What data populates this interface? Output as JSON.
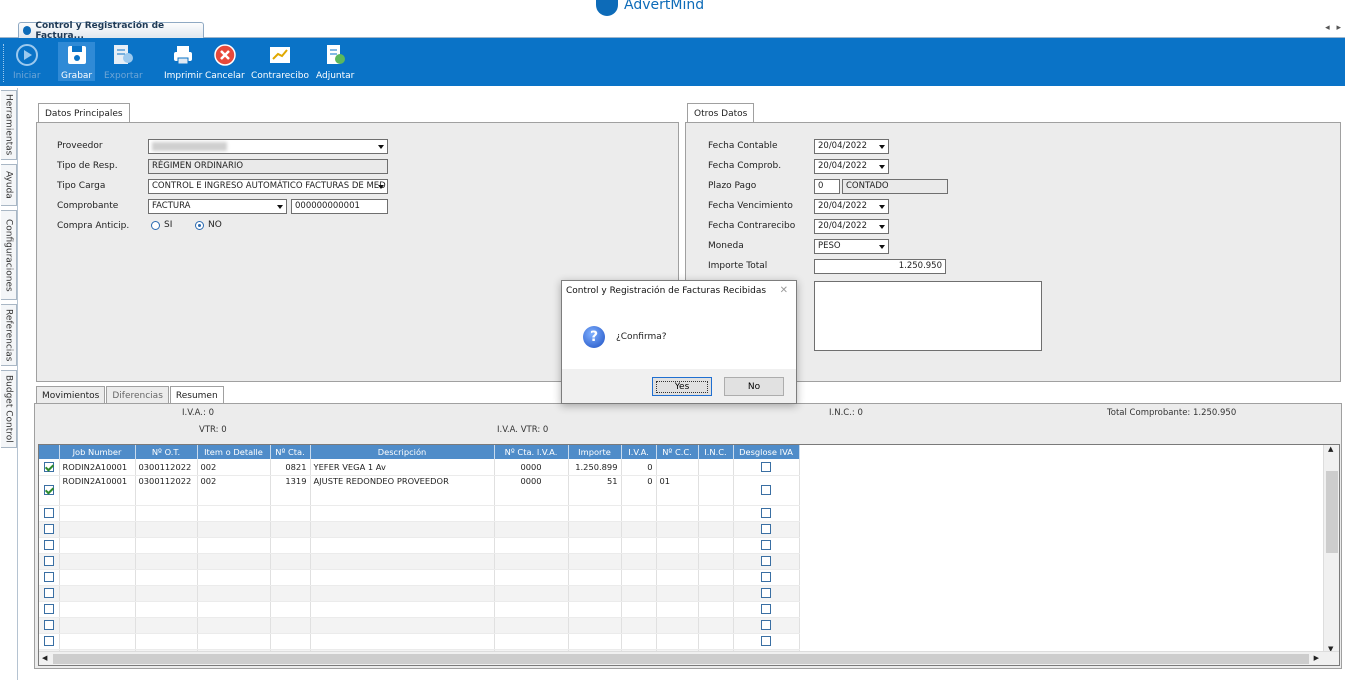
{
  "brand": {
    "name": "AdvertMind"
  },
  "window": {
    "tab_title": "Control y Registración de Factura...",
    "nav": "◂ ▸"
  },
  "toolbar": {
    "iniciar": "Iniciar",
    "grabar": "Grabar",
    "exportar": "Exportar",
    "imprimir": "Imprimir",
    "cancelar": "Cancelar",
    "contrarecibo": "Contrarecibo",
    "adjuntar": "Adjuntar"
  },
  "sidebar": {
    "tabs": [
      "Herramientas",
      "Ayuda",
      "Configuraciones",
      "Referencias",
      "Budget Control"
    ]
  },
  "datos_principales": {
    "tab": "Datos Principales",
    "proveedor_label": "Proveedor",
    "tipo_resp_label": "Tipo de Resp.",
    "tipo_resp_value": "RÉGIMEN ORDINARIO",
    "tipo_carga_label": "Tipo Carga",
    "tipo_carga_value": "CONTROL E INGRESO AUTOMÁTICO FACTURAS DE MED",
    "comprobante_label": "Comprobante",
    "comprobante_value": "FACTURA",
    "comprobante_num": "000000000001",
    "compra_label": "Compra Anticip.",
    "si": "SI",
    "no": "NO",
    "selected": "NO"
  },
  "otros_datos": {
    "tab": "Otros Datos",
    "fecha_contable_label": "Fecha Contable",
    "fecha_contable": "20/04/2022",
    "fecha_comprob_label": "Fecha Comprob.",
    "fecha_comprob": "20/04/2022",
    "plazo_label": "Plazo Pago",
    "plazo_value": "0",
    "plazo_desc": "CONTADO",
    "fecha_venc_label": "Fecha Vencimiento",
    "fecha_venc": "20/04/2022",
    "fecha_contra_label": "Fecha Contrarecibo",
    "fecha_contra": "20/04/2022",
    "moneda_label": "Moneda",
    "moneda": "PESO",
    "importe_label": "Importe Total",
    "importe": "1.250.950"
  },
  "bottom_tabs": [
    "Movimientos",
    "Diferencias",
    "Resumen"
  ],
  "resumen": {
    "iva": "I.V.A.: 0",
    "vtr": "VTR: 0",
    "iva_vtr": "I.V.A. VTR: 0",
    "inc": "I.N.C.: 0",
    "total": "Total Comprobante: 1.250.950"
  },
  "grid": {
    "columns": [
      "",
      "Job Number",
      "Nº O.T.",
      "Item o Detalle",
      "Nº Cta.",
      "Descripción",
      "Nº Cta. I.V.A.",
      "Importe",
      "I.V.A.",
      "Nº C.C.",
      "I.N.C.",
      "Desglose IVA"
    ],
    "rows": [
      {
        "job": "RODIN2A10001",
        "ot": "0300112022",
        "item": "002",
        "cta": "0821",
        "desc": "YEFER VEGA 1 Av",
        "cta_iva": "0000",
        "importe": "1.250.899",
        "iva": "0",
        "cc": "",
        "inc": ""
      },
      {
        "job": "RODIN2A10001",
        "ot": "0300112022",
        "item": "002",
        "cta": "1319",
        "desc": "AJUSTE REDONDEO PROVEEDOR",
        "cta_iva": "0000",
        "importe": "51",
        "iva": "0",
        "cc": "01",
        "inc": ""
      }
    ]
  },
  "dialog": {
    "title": "Control y Registración de Facturas Recibidas",
    "message": "¿Confirma?",
    "yes": "Yes",
    "no": "No"
  }
}
